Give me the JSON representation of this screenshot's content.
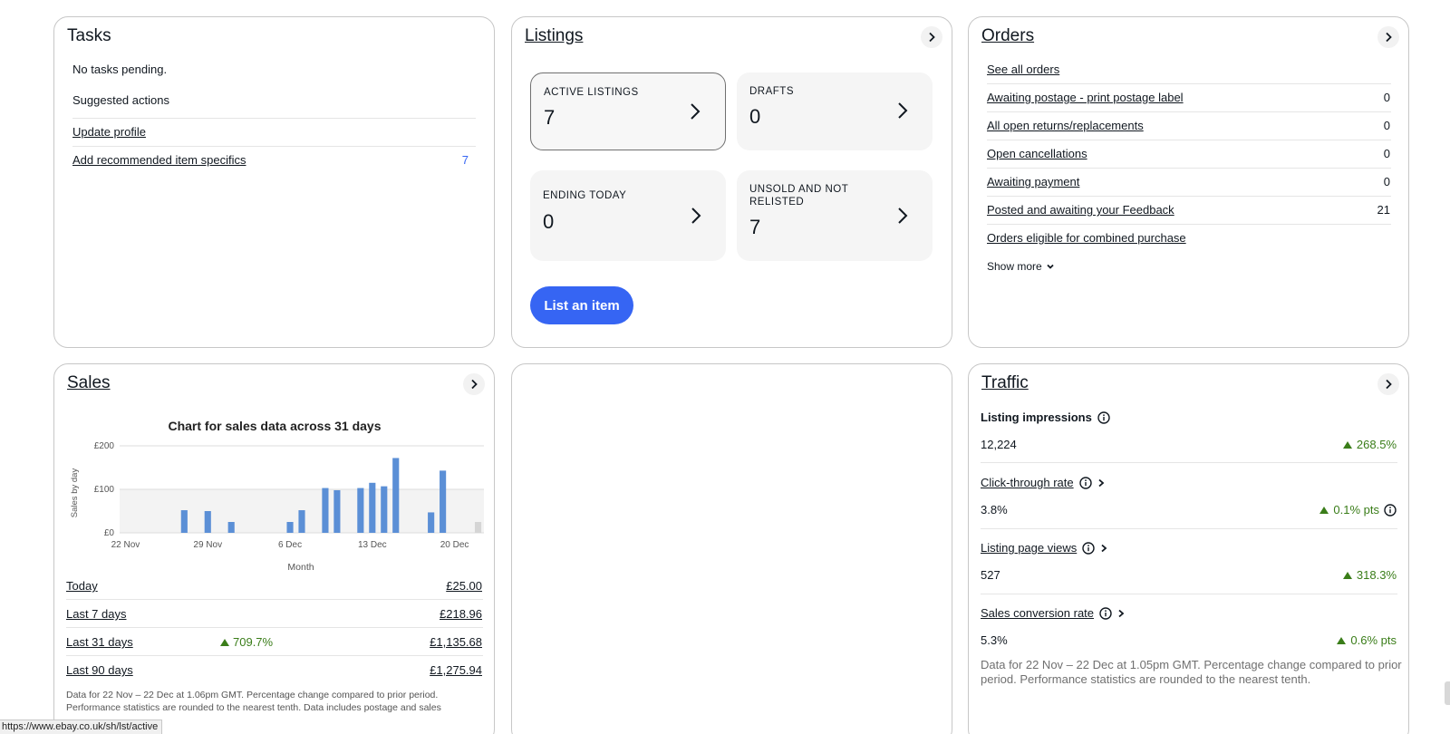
{
  "tasks": {
    "title": "Tasks",
    "no_tasks": "No tasks pending.",
    "suggested_heading": "Suggested actions",
    "items": [
      {
        "label": "Update profile",
        "count": ""
      },
      {
        "label": "Add recommended item specifics",
        "count": "7"
      }
    ]
  },
  "listings": {
    "title": "Listings",
    "tiles": [
      {
        "label": "ACTIVE LISTINGS",
        "value": "7"
      },
      {
        "label": "DRAFTS",
        "value": "0"
      },
      {
        "label": "ENDING TODAY",
        "value": "0"
      },
      {
        "label": "UNSOLD AND NOT RELISTED",
        "value": "7"
      }
    ],
    "list_button": "List an item"
  },
  "orders": {
    "title": "Orders",
    "see_all": "See all orders",
    "rows": [
      {
        "label": "Awaiting postage - print postage label",
        "count": "0"
      },
      {
        "label": "All open returns/replacements",
        "count": "0"
      },
      {
        "label": "Open cancellations",
        "count": "0"
      },
      {
        "label": "Awaiting payment",
        "count": "0"
      },
      {
        "label": "Posted and awaiting your Feedback",
        "count": "21"
      },
      {
        "label": "Orders eligible for combined purchase",
        "count": ""
      }
    ],
    "show_more": "Show more"
  },
  "sales": {
    "title": "Sales",
    "periods": [
      {
        "label": "Today",
        "change": "",
        "value": "£25.00"
      },
      {
        "label": "Last 7 days",
        "change": "",
        "value": "£218.96"
      },
      {
        "label": "Last 31 days",
        "change": "709.7%",
        "value": "£1,135.68"
      },
      {
        "label": "Last 90 days",
        "change": "",
        "value": "£1,275.94"
      }
    ],
    "footnote": "Data for 22 Nov – 22 Dec at 1.06pm GMT. Percentage change compared to prior period. Performance statistics are rounded to the nearest tenth. Data includes postage and sales"
  },
  "chart_data": {
    "type": "bar",
    "title": "Chart for sales data across 31 days",
    "xlabel": "Month",
    "ylabel": "Sales by day",
    "ylim": [
      0,
      200
    ],
    "y_ticks": [
      "£0",
      "£100",
      "£200"
    ],
    "y_tick_values": [
      0,
      100,
      200
    ],
    "x_ticks": [
      "22 Nov",
      "29 Nov",
      "6 Dec",
      "13 Dec",
      "20 Dec"
    ],
    "x_tick_days": [
      0,
      7,
      14,
      21,
      28
    ],
    "days": 31,
    "series": [
      {
        "values": [
          0,
          0,
          0,
          0,
          0,
          52,
          0,
          50,
          0,
          25,
          0,
          0,
          0,
          0,
          25,
          52,
          0,
          103,
          98,
          0,
          103,
          115,
          107,
          172,
          0,
          0,
          47,
          143,
          0,
          0,
          25
        ]
      }
    ],
    "bar_color": "#5b8fd6",
    "today_bar_color": "#d5d5d5",
    "grid": true,
    "shaded_band": [
      0,
      100
    ]
  },
  "traffic": {
    "title": "Traffic",
    "metrics": [
      {
        "label": "Listing impressions",
        "value": "12,224",
        "change": "268.5%"
      },
      {
        "label": "Click-through rate",
        "value": "3.8%",
        "change": "0.1% pts"
      },
      {
        "label": "Listing page views",
        "value": "527",
        "change": "318.3%"
      },
      {
        "label": "Sales conversion rate",
        "value": "5.3%",
        "change": "0.6% pts"
      }
    ],
    "footnote": "Data for 22 Nov – 22 Dec at 1.05pm GMT. Percentage change compared to prior period. Performance statistics are rounded to the nearest tenth."
  },
  "status_bar": {
    "url": "https://www.ebay.co.uk/sh/lst/active"
  },
  "colors": {
    "accent": "#3665f3",
    "positive": "#3a7d19",
    "border": "#c7c7c7"
  }
}
